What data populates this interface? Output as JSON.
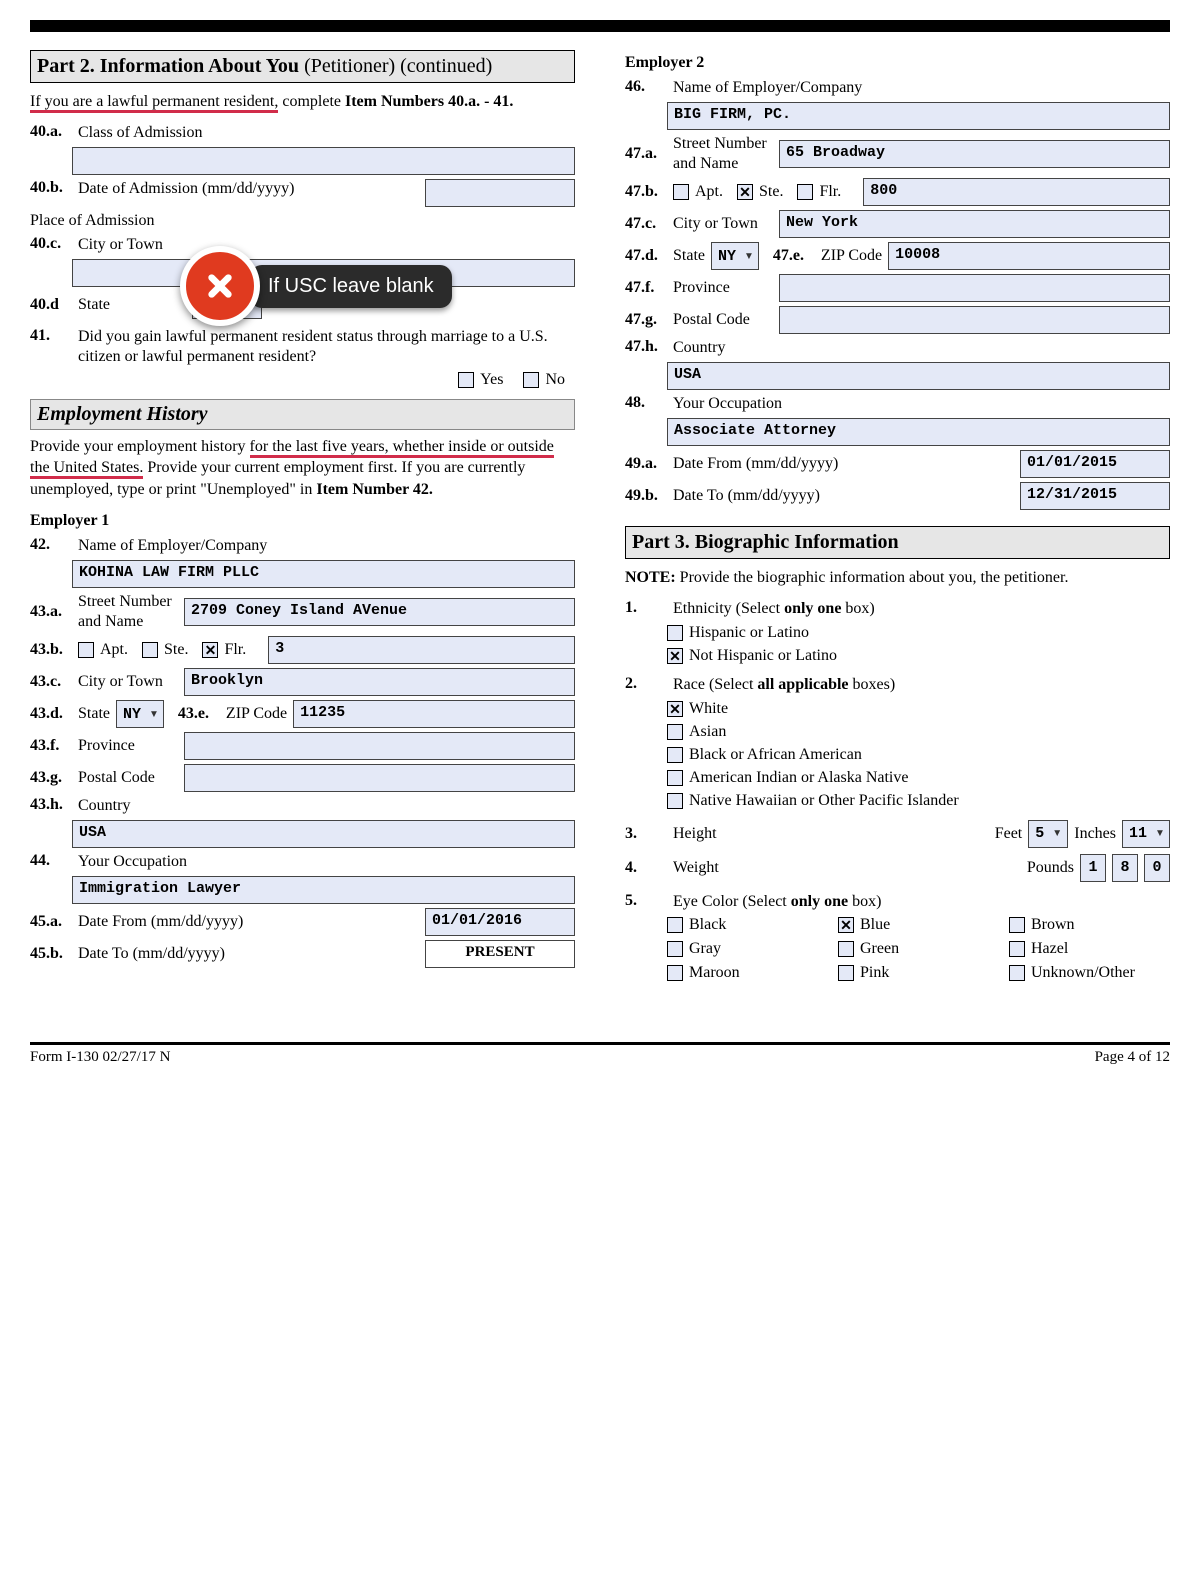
{
  "part2": {
    "header_bold": "Part 2.  Information About You",
    "header_rest": " (Petitioner) (continued)",
    "lpr_instr_pre": "If you are a lawful permanent resident,",
    "lpr_instr_post": " complete ",
    "lpr_instr_bold": "Item Numbers 40.a. - 41.",
    "n40a": "40.a.",
    "l40a": "Class of Admission",
    "n40b": "40.b.",
    "l40b": "Date of Admission (mm/dd/yyyy)",
    "l_place": "Place of Admission",
    "n40c": "40.c.",
    "l40c": "City or Town",
    "n40d": "40.d",
    "l40d": "State",
    "n41": "41.",
    "l41": "Did you gain lawful permanent resident status through marriage to a U.S. citizen or lawful permanent resident?",
    "yes": "Yes",
    "no": "No",
    "emp_hist_header": "Employment History",
    "emp_instr": "Provide your employment history for the last five years, whether inside or outside the United States.  Provide your current employment first.  If you are currently unemployed, type or print \"Unemployed\" in ",
    "emp_instr_bold": "Item Number 42.",
    "emp1_head": "Employer 1",
    "n42": "42.",
    "l42": "Name of Employer/Company",
    "v42": "KOHINA LAW FIRM PLLC",
    "n43a": "43.a.",
    "l43a1": "Street Number",
    "l43a2": "and Name",
    "v43a": "2709 Coney Island AVenue",
    "n43b": "43.b.",
    "apt": "Apt.",
    "ste": "Ste.",
    "flr": "Flr.",
    "v43b": "3",
    "n43c": "43.c.",
    "l43c": "City or Town",
    "v43c": "Brooklyn",
    "n43d": "43.d.",
    "l43d": "State",
    "v43d": "NY",
    "n43e": "43.e.",
    "l43e": "ZIP Code",
    "v43e": "11235",
    "n43f": "43.f.",
    "l43f": "Province",
    "n43g": "43.g.",
    "l43g": "Postal Code",
    "n43h": "43.h.",
    "l43h": "Country",
    "v43h": "USA",
    "n44": "44.",
    "l44": "Your Occupation",
    "v44": "Immigration Lawyer",
    "n45a": "45.a.",
    "l45a": "Date From (mm/dd/yyyy)",
    "v45a": "01/01/2016",
    "n45b": "45.b.",
    "l45b": "Date To (mm/dd/yyyy)",
    "v45b": "PRESENT"
  },
  "employer2": {
    "head": "Employer 2",
    "n46": "46.",
    "l46": "Name of Employer/Company",
    "v46": "BIG FIRM, PC.",
    "n47a": "47.a.",
    "l47a1": "Street Number",
    "l47a2": "and Name",
    "v47a": "65 Broadway",
    "n47b": "47.b.",
    "v47b": "800",
    "n47c": "47.c.",
    "l47c": "City or Town",
    "v47c": "New York",
    "n47d": "47.d.",
    "l47d": "State",
    "v47d": "NY",
    "n47e": "47.e.",
    "l47e": "ZIP Code",
    "v47e": "10008",
    "n47f": "47.f.",
    "l47f": "Province",
    "n47g": "47.g.",
    "l47g": "Postal Code",
    "n47h": "47.h.",
    "l47h": "Country",
    "v47h": "USA",
    "n48": "48.",
    "l48": "Your Occupation",
    "v48": "Associate Attorney",
    "n49a": "49.a.",
    "l49a": "Date From (mm/dd/yyyy)",
    "v49a": "01/01/2015",
    "n49b": "49.b.",
    "l49b": "Date To (mm/dd/yyyy)",
    "v49b": "12/31/2015"
  },
  "part3": {
    "header_bold": "Part 3.  Biographic Information",
    "note_b": "NOTE:",
    "note": "  Provide the biographic information about you, the petitioner.",
    "n1": "1.",
    "l1_pre": "Ethnicity (Select ",
    "l1_b": "only one",
    "l1_post": " box)",
    "e_hisp": "Hispanic or Latino",
    "e_nhisp": "Not Hispanic or Latino",
    "n2": "2.",
    "l2_pre": "Race (Select ",
    "l2_b": "all applicable",
    "l2_post": " boxes)",
    "r_white": "White",
    "r_asian": "Asian",
    "r_black": "Black or African American",
    "r_aian": "American Indian or Alaska Native",
    "r_nhpi": "Native Hawaiian or Other Pacific Islander",
    "n3": "3.",
    "l3": "Height",
    "feet": "Feet",
    "inches": "Inches",
    "v3_ft": "5",
    "v3_in": "11",
    "n4": "4.",
    "l4": "Weight",
    "pounds": "Pounds",
    "v4_1": "1",
    "v4_2": "8",
    "v4_3": "0",
    "n5": "5.",
    "l5_pre": "Eye Color (Select ",
    "l5_b": "only one",
    "l5_post": " box)",
    "c_black": "Black",
    "c_blue": "Blue",
    "c_brown": "Brown",
    "c_gray": "Gray",
    "c_green": "Green",
    "c_hazel": "Hazel",
    "c_maroon": "Maroon",
    "c_pink": "Pink",
    "c_other": "Unknown/Other"
  },
  "tooltip": "If USC leave blank",
  "footer": {
    "left": "Form I-130   02/27/17   N",
    "right": "Page 4 of 12"
  }
}
